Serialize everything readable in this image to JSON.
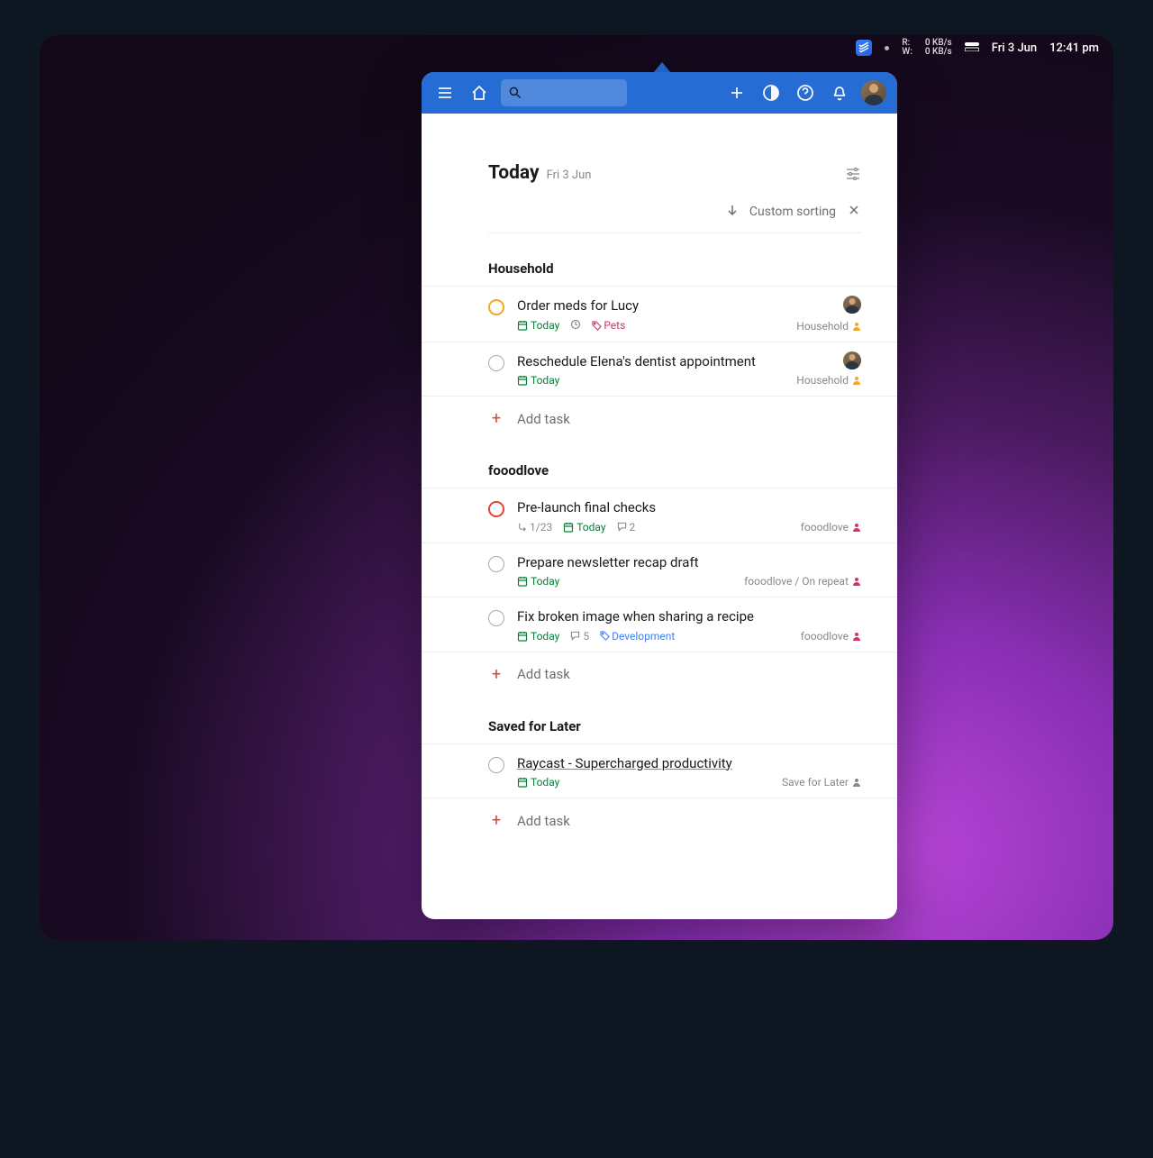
{
  "menubar": {
    "rw_r_label": "R:",
    "rw_w_label": "W:",
    "net_up": "0 KB/s",
    "net_down": "0 KB/s",
    "date": "Fri 3 Jun",
    "time": "12:41 pm"
  },
  "header": {
    "title": "Today",
    "date": "Fri 3 Jun"
  },
  "sort": {
    "label": "Custom sorting"
  },
  "strings": {
    "add_task": "Add task",
    "today": "Today"
  },
  "sections": [
    {
      "title": "Household",
      "tasks": [
        {
          "title": "Order meds for Lucy",
          "priority": "orange",
          "due": "Today",
          "recurring": true,
          "tag": "Pets",
          "tagColor": "pink",
          "project": "Household",
          "projColor": "orange",
          "avatar": true
        },
        {
          "title": "Reschedule Elena's dentist appointment",
          "priority": "none",
          "due": "Today",
          "project": "Household",
          "projColor": "orange",
          "avatar": true
        }
      ]
    },
    {
      "title": "fooodlove",
      "tasks": [
        {
          "title": "Pre-launch final checks",
          "priority": "red",
          "subtasks": "1/23",
          "due": "Today",
          "comments": "2",
          "project": "fooodlove",
          "projColor": "magenta"
        },
        {
          "title": "Prepare newsletter recap draft",
          "priority": "none",
          "due": "Today",
          "project": "fooodlove / On repeat",
          "projColor": "magenta"
        },
        {
          "title": "Fix broken image when sharing a recipe",
          "priority": "none",
          "due": "Today",
          "comments": "5",
          "tag": "Development",
          "tagColor": "blue",
          "project": "fooodlove",
          "projColor": "magenta"
        }
      ]
    },
    {
      "title": "Saved for Later",
      "tasks": [
        {
          "title": "Raycast - Supercharged productivity",
          "isLink": true,
          "priority": "none",
          "due": "Today",
          "project": "Save for Later",
          "projColor": "grey"
        }
      ]
    }
  ]
}
